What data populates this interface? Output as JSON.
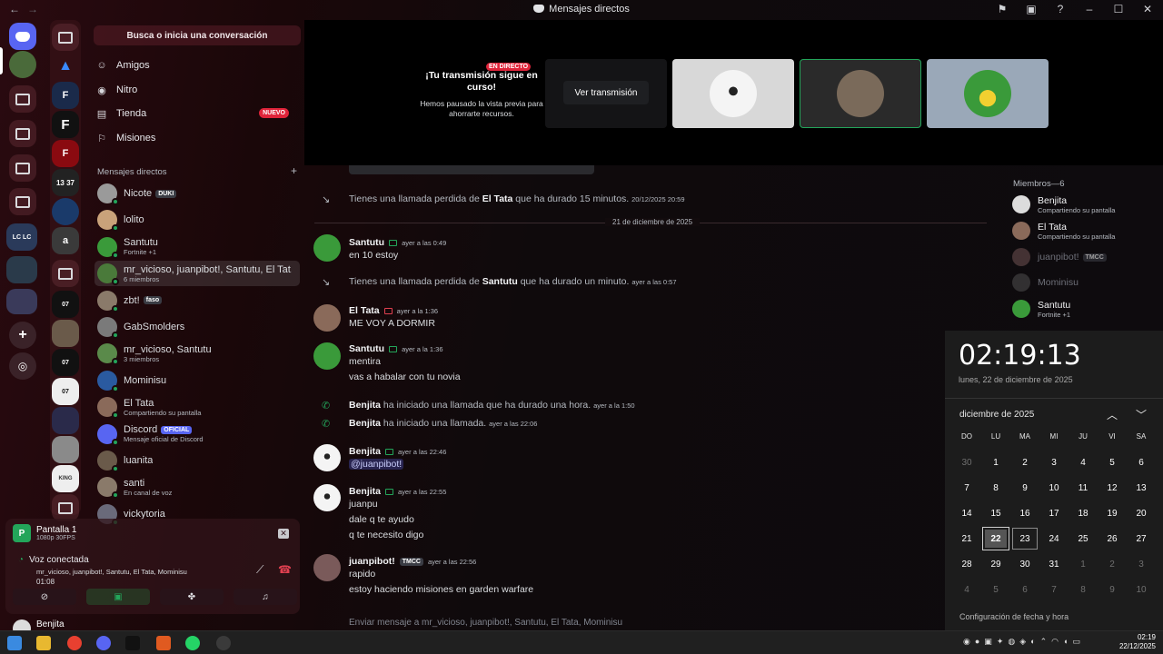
{
  "window": {
    "title": "Mensajes directos",
    "nav_back": "←",
    "nav_fwd": "→"
  },
  "sidebar": {
    "search_placeholder": "Busca o inicia una conversación",
    "nav": [
      {
        "label": "Amigos",
        "icon": "friends-icon"
      },
      {
        "label": "Nitro",
        "icon": "nitro-icon"
      },
      {
        "label": "Tienda",
        "icon": "shop-icon",
        "badge": "NUEVO"
      },
      {
        "label": "Misiones",
        "icon": "quests-icon"
      }
    ],
    "dm_header": "Mensajes directos",
    "dm_add": "+",
    "dms": [
      {
        "name": "Nicote",
        "tag": "DUKI",
        "sub": "",
        "color": "#9a9a9a"
      },
      {
        "name": "lolito",
        "sub": "",
        "color": "#c9a27a"
      },
      {
        "name": "Santutu",
        "sub": "Fortnite +1",
        "color": "#3a9a3a"
      },
      {
        "name": "mr_vicioso, juanpibot!, Santutu, El Tat...",
        "sub": "6 miembros",
        "color": "#4a7a3a"
      },
      {
        "name": "zbt!",
        "tag": "faso",
        "sub": "",
        "color": "#8a7a6a"
      },
      {
        "name": "GabSmolders",
        "sub": "",
        "color": "#7a7a7a"
      },
      {
        "name": "mr_vicioso, Santutu",
        "sub": "3 miembros",
        "color": "#5a8a4a"
      },
      {
        "name": "Mominisu",
        "sub": "",
        "color": "#2a5aa0"
      },
      {
        "name": "El Tata",
        "sub": "Compartiendo su pantalla",
        "color": "#8a6a5a"
      },
      {
        "name": "Discord",
        "tag": "OFICIAL",
        "sub": "Mensaje oficial de Discord",
        "color": "#5865f2"
      },
      {
        "name": "luanita",
        "sub": "",
        "color": "#6a5a4a"
      },
      {
        "name": "santi",
        "sub": "En canal de voz",
        "color": "#8a7a6a"
      },
      {
        "name": "vickytoria",
        "sub": "",
        "color": "#6a6a7a"
      }
    ]
  },
  "voice": {
    "stream_title": "Pantalla 1",
    "stream_quality": "1080p 30FPS",
    "connected": "Voz conectada",
    "members": "mr_vicioso, juanpibot!, Santutu, El Tata, Mominisu",
    "time": "01:08"
  },
  "user": {
    "name": "Benjita"
  },
  "banner": {
    "live": "EN DIRECTO",
    "title": "¡Tu transmisión sigue en curso!",
    "desc": "Hemos pausado la vista previa para ahorrarte recursos.",
    "watch": "Ver transmisión"
  },
  "chat": {
    "date_divider": "21 de diciembre de 2025",
    "missed1": {
      "pre": "Tienes una llamada perdida de ",
      "who": "El Tata",
      "post": " que ha durado 15 minutos.",
      "ts": "20/12/2025 20:59"
    },
    "m1": {
      "name": "Santutu",
      "ts": "ayer a las 0:49",
      "lines": [
        "en 10 estoy"
      ]
    },
    "missed2": {
      "pre": "Tienes una llamada perdida de ",
      "who": "Santutu",
      "post": " que ha durado un minuto.",
      "ts": "ayer a las 0:57"
    },
    "m2": {
      "name": "El Tata",
      "ts": "ayer a la 1:36",
      "lines": [
        "ME VOY A DORMIR"
      ]
    },
    "m3": {
      "name": "Santutu",
      "ts": "ayer a la 1:36",
      "lines": [
        "mentira",
        "vas a habalar con tu novia"
      ]
    },
    "call1": {
      "who": "Benjita",
      "post": " ha iniciado una llamada que ha durado una hora.",
      "ts": "ayer a la 1:50"
    },
    "call2": {
      "who": "Benjita",
      "post": " ha iniciado una llamada.",
      "ts": "ayer a las 22:06"
    },
    "m4": {
      "name": "Benjita",
      "ts": "ayer a las 22:46",
      "lines": [
        "@juanpibot!"
      ]
    },
    "m5": {
      "name": "Benjita",
      "ts": "ayer a las 22:55",
      "lines": [
        "juanpu",
        "dale q te ayudo",
        "q te necesito digo"
      ]
    },
    "m6": {
      "name": "juanpibot!",
      "tag": "TMCC",
      "ts": "ayer a las 22:56",
      "lines": [
        "rapido",
        "estoy haciendo misiones en garden warfare"
      ]
    },
    "composer_placeholder": "Enviar mensaje a mr_vicioso, juanpibot!, Santutu, El Tata, Mominisu"
  },
  "members": {
    "header": "Miembros—6",
    "list": [
      {
        "name": "Benjita",
        "sub": "Compartiendo su pantalla",
        "color": "#dcdcdc"
      },
      {
        "name": "El Tata",
        "sub": "Compartiendo su pantalla",
        "color": "#8a6a5a"
      },
      {
        "name": "juanpibot!",
        "tag": "TMCC",
        "sub": "",
        "color": "#7a5a5a"
      },
      {
        "name": "Mominisu",
        "sub": "",
        "color": "#555"
      },
      {
        "name": "Santutu",
        "sub": "Fortnite +1",
        "color": "#3a9a3a"
      }
    ]
  },
  "calendar": {
    "time": "02:19:13",
    "date": "lunes, 22 de diciembre de 2025",
    "month": "diciembre de 2025",
    "dow": [
      "DO",
      "LU",
      "MA",
      "MI",
      "JU",
      "VI",
      "SA"
    ],
    "days": [
      "30",
      "1",
      "2",
      "3",
      "4",
      "5",
      "6",
      "7",
      "8",
      "9",
      "10",
      "11",
      "12",
      "13",
      "14",
      "15",
      "16",
      "17",
      "18",
      "19",
      "20",
      "21",
      "22",
      "23",
      "24",
      "25",
      "26",
      "27",
      "28",
      "29",
      "30",
      "31",
      "1",
      "2",
      "3",
      "4",
      "5",
      "6",
      "7",
      "8",
      "9",
      "10"
    ],
    "settings_link": "Configuración de fecha y hora"
  },
  "taskbar": {
    "time": "02:19",
    "date": "22/12/2025"
  }
}
